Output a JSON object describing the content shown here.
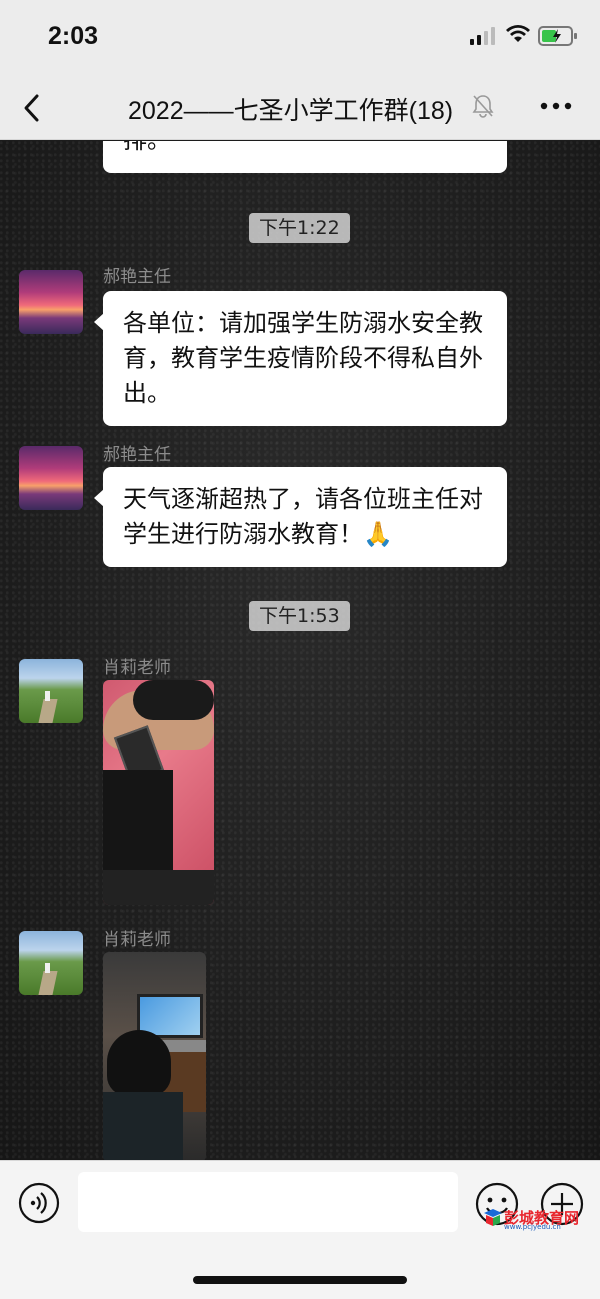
{
  "status_bar": {
    "time": "2:03"
  },
  "nav": {
    "title": "2022——七圣小学工作群(18)"
  },
  "chat": {
    "partial_message": "排。",
    "messages": [
      {
        "time_divider": "下午1:22"
      },
      {
        "sender": "郝艳主任",
        "text": "各单位：请加强学生防溺水安全教育，教育学生疫情阶段不得私自外出。"
      },
      {
        "sender": "郝艳主任",
        "text": "天气逐渐超热了，请各位班主任对学生进行防溺水教育！🙏"
      },
      {
        "time_divider": "下午1:53"
      },
      {
        "sender": "肖莉老师",
        "image": "photo-student-on-phone"
      },
      {
        "sender": "肖莉老师",
        "image": "photo-student-at-laptop"
      }
    ]
  },
  "labels": {
    "time1": "下午1:22",
    "time2": "下午1:53",
    "sender1": "郝艳主任",
    "msg1": "各单位：请加强学生防溺水安全教育，教育学生疫情阶段不得私自外出。",
    "sender2": "郝艳主任",
    "msg2": "天气逐渐超热了，请各位班主任对学生进行防溺水教育！",
    "msg2_emoji": "🙏",
    "sender3": "肖莉老师",
    "sender4": "肖莉老师"
  },
  "watermark": {
    "name": "彭城教育网",
    "url": "www.pcjyedu.cn"
  },
  "icons": {
    "back": "chevron-left-icon",
    "mute": "bell-off-icon",
    "more": "more-dots-icon",
    "voice": "voice-icon",
    "emoji": "emoji-icon",
    "plus": "plus-icon"
  }
}
